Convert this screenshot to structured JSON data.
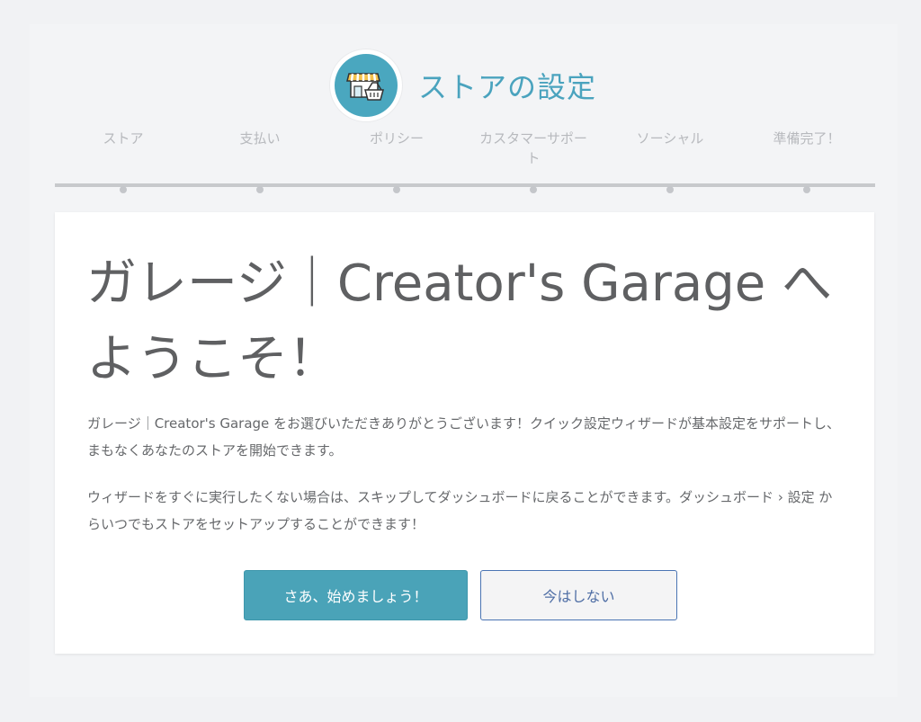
{
  "header": {
    "title": "ストアの設定",
    "logo_icon": "storefront-basket-icon"
  },
  "steps": [
    {
      "label": "ストア"
    },
    {
      "label": "支払い"
    },
    {
      "label": "ポリシー"
    },
    {
      "label": "カスタマーサポート"
    },
    {
      "label": "ソーシャル"
    },
    {
      "label": "準備完了！"
    }
  ],
  "welcome": {
    "heading": "ガレージ｜Creator's Garage へようこそ！",
    "paragraph_1": "ガレージ｜Creator's Garage をお選びいただきありがとうございます！クイック設定ウィザードが基本設定をサポートし、まもなくあなたのストアを開始できます。",
    "paragraph_2": "ウィザードをすぐに実行したくない場合は、スキップしてダッシュボードに戻ることができます。ダッシュボード › 設定 からいつでもストアをセットアップすることができます！",
    "primary_button": "さあ、始めましょう！",
    "secondary_button": "今はしない"
  },
  "colors": {
    "accent": "#4aa3b8",
    "title": "#4aa3be",
    "secondary_border": "#4a74b3"
  }
}
